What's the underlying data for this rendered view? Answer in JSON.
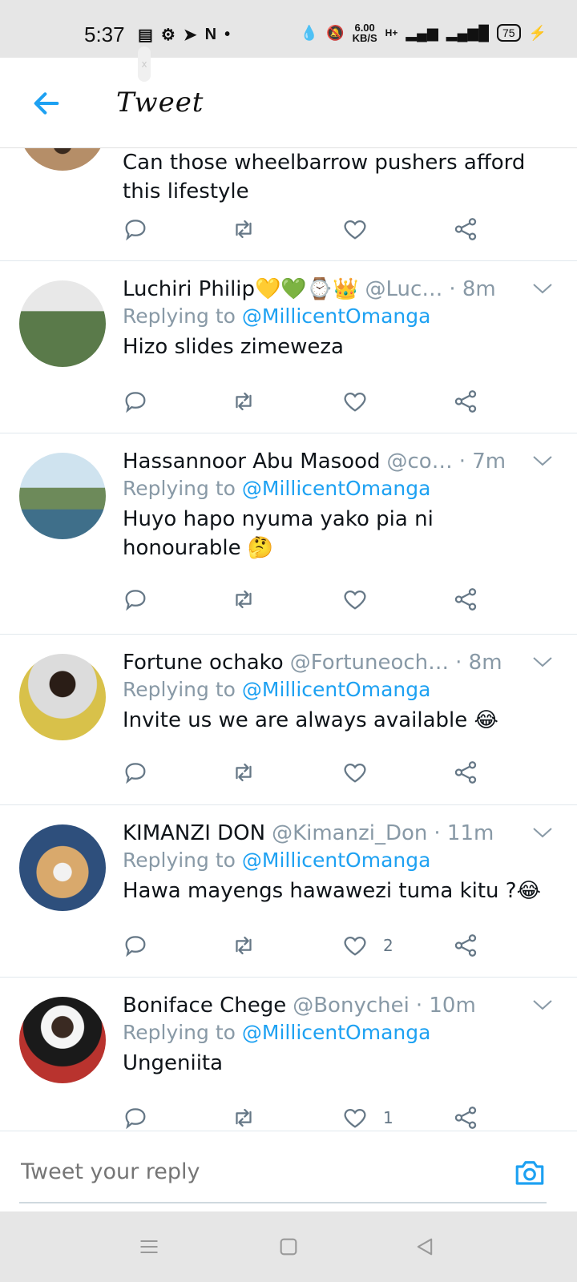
{
  "status_bar": {
    "time": "5:37",
    "net_speed_value": "6.00",
    "net_speed_unit": "KB/S",
    "network_type": "H+",
    "battery_level": "75"
  },
  "header": {
    "title": "Tweet"
  },
  "reply_prefix": "Replying to",
  "partial_tweet": {
    "text": "Can those wheelbarrow pushers afford this lifestyle"
  },
  "tweets": [
    {
      "name": "Luchiri Philip💛💚⌚👑",
      "handle": "@Luc…",
      "time": "· 8m",
      "mention": "@MillicentOmanga",
      "text": "Hizo slides zimeweza",
      "likes": ""
    },
    {
      "name": "Hassannoor Abu Masood",
      "handle": "@co…",
      "time": "· 7m",
      "mention": "@MillicentOmanga",
      "text": "Huyo hapo nyuma yako pia ni honourable 🤔",
      "likes": ""
    },
    {
      "name": "Fortune ochako",
      "handle": "@Fortuneoch…",
      "time": "· 8m",
      "mention": "@MillicentOmanga",
      "text": "Invite us we are always available 😂",
      "likes": ""
    },
    {
      "name": "KIMANZI DON",
      "handle": "@Kimanzi_Don",
      "time": "· 11m",
      "mention": "@MillicentOmanga",
      "text": "Hawa mayengs hawawezi tuma kitu ?😂",
      "likes": "2"
    },
    {
      "name": "Boniface Chege",
      "handle": "@Bonychei",
      "time": "· 10m",
      "mention": "@MillicentOmanga",
      "text": "Ungeniita",
      "likes": "1"
    }
  ],
  "composer": {
    "placeholder": "Tweet your reply"
  },
  "icons": {
    "back": "arrow-left-icon",
    "reply": "speech-bubble-icon",
    "retweet": "retweet-icon",
    "like": "heart-icon",
    "share": "share-icon",
    "camera": "camera-icon"
  },
  "colors": {
    "accent": "#1da1f2",
    "muted": "#8899a6",
    "text": "#0f1419"
  }
}
